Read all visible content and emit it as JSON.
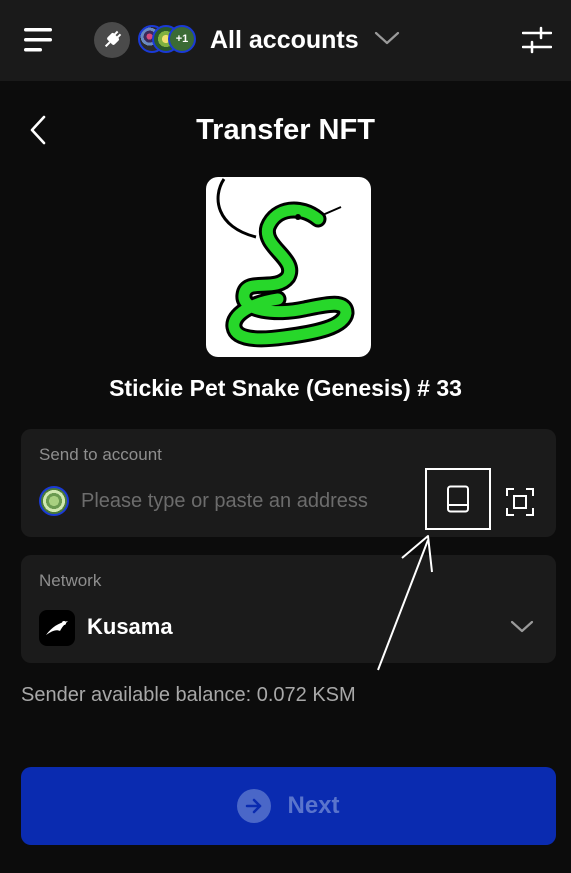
{
  "header": {
    "account_selector_label": "All accounts",
    "more_accounts_badge": "+1",
    "icons": [
      "menu-icon",
      "plug-icon",
      "chevron-down-icon",
      "settings-sliders-icon"
    ]
  },
  "page": {
    "title": "Transfer NFT",
    "back_icon": "chevron-left-icon"
  },
  "nft": {
    "name": "Stickie Pet Snake (Genesis) # 33"
  },
  "send_to": {
    "label": "Send to account",
    "placeholder": "Please type or paste an address",
    "value": "",
    "icons": [
      "address-book-icon",
      "scan-qr-icon"
    ]
  },
  "network": {
    "label": "Network",
    "selected": "Kusama"
  },
  "balance_text": "Sender available balance: 0.072 KSM",
  "next_button": {
    "label": "Next"
  },
  "colors": {
    "background": "#0c0c0c",
    "header_bg": "#1a1a1a",
    "card_bg": "#1b1b1b",
    "primary_button": "#0a2bb0",
    "muted_text": "#8e8e8e",
    "snake_green": "#27d72a"
  }
}
